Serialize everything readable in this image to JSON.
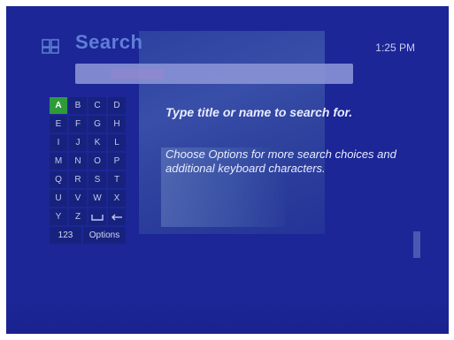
{
  "header": {
    "title": "Search",
    "time": "1:25 PM"
  },
  "search": {
    "value": ""
  },
  "keyboard": {
    "selected_key": "A",
    "rows": [
      [
        "A",
        "B",
        "C",
        "D"
      ],
      [
        "E",
        "F",
        "G",
        "H"
      ],
      [
        "I",
        "J",
        "K",
        "L"
      ],
      [
        "M",
        "N",
        "O",
        "P"
      ],
      [
        "Q",
        "R",
        "S",
        "T"
      ],
      [
        "U",
        "V",
        "W",
        "X"
      ],
      [
        "Y",
        "Z",
        "␣",
        "←"
      ]
    ],
    "numbers_label": "123",
    "options_label": "Options"
  },
  "help": {
    "line1": "Type title or name to search for.",
    "line2": "Choose Options for more search choices and additional keyboard characters."
  },
  "colors": {
    "background": "#1c2696",
    "selected_key": "#2f9a3a",
    "title": "#5f7fd6"
  },
  "icons": {
    "logo": "media-center-logo-icon",
    "space": "space-icon",
    "backspace": "backspace-icon"
  }
}
